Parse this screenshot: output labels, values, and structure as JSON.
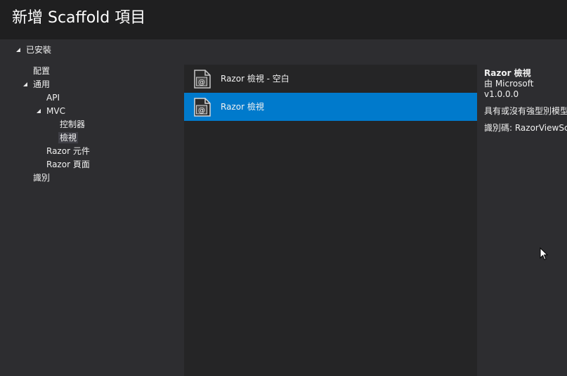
{
  "dialog": {
    "title": "新增 Scaffold 項目"
  },
  "tree": {
    "root_label": "已安裝",
    "items": [
      {
        "label": "配置"
      },
      {
        "label": "通用"
      },
      {
        "label": "API"
      },
      {
        "label": "MVC"
      },
      {
        "label": "控制器"
      },
      {
        "label": "檢視"
      },
      {
        "label": "Razor 元件"
      },
      {
        "label": "Razor 頁面"
      },
      {
        "label": "識別"
      }
    ],
    "selected": "檢視"
  },
  "templates": {
    "items": [
      {
        "label": "Razor 檢視 - 空白",
        "icon": "razor-file-icon"
      },
      {
        "label": "Razor 檢視",
        "icon": "razor-file-icon"
      }
    ],
    "selected_index": 1
  },
  "details": {
    "name": "Razor 檢視",
    "author": "由 Microsoft",
    "version": "v1.0.0.0",
    "description": "具有或沒有強型別模型",
    "id_text": "識別碼: RazorViewSca"
  },
  "colors": {
    "accent": "#007acc",
    "background": "#2d2d30",
    "title_bar": "#1f1f20",
    "list_background": "#252526"
  }
}
